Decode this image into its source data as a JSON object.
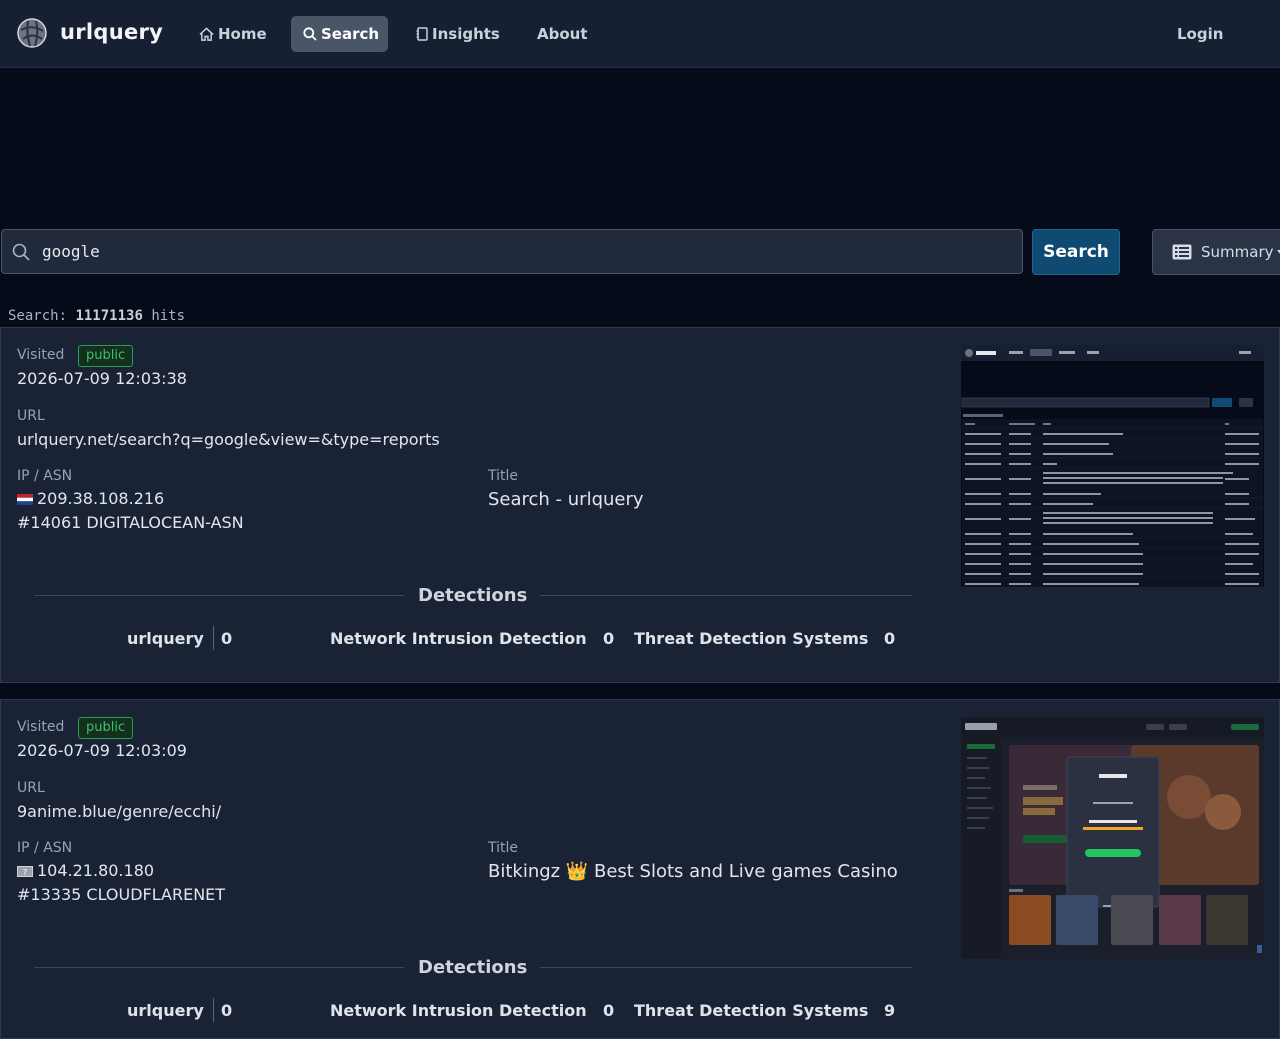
{
  "nav": {
    "brand": "urlquery",
    "home": "Home",
    "search": "Search",
    "insights": "Insights",
    "about": "About",
    "login": "Login"
  },
  "search": {
    "query": "google",
    "button": "Search",
    "view_label": "Summary"
  },
  "hits": {
    "prefix": "Search:",
    "count": "11171136",
    "suffix": "hits"
  },
  "labels": {
    "visited": "Visited",
    "url": "URL",
    "ip_asn": "IP / ASN",
    "title": "Title",
    "detections": "Detections",
    "det_urlquery": "urlquery",
    "det_nids": "Network Intrusion Detection",
    "det_tds": "Threat Detection Systems"
  },
  "results": [
    {
      "visibility": "public",
      "visited": "2026-07-09 12:03:38",
      "url": "urlquery.net/search?q=google&view=&type=reports",
      "ip": "209.38.108.216",
      "asn": "#14061 DIGITALOCEAN-ASN",
      "title": "Search - urlquery",
      "det_urlquery": "0",
      "det_nids": "0",
      "det_tds": "0",
      "flag": "netherlands-flag"
    },
    {
      "visibility": "public",
      "visited": "2026-07-09 12:03:09",
      "url": "9anime.blue/genre/ecchi/",
      "ip": "104.21.80.180",
      "asn": "#13335 CLOUDFLARENET",
      "title": "Bitkingz 👑 Best Slots and Live games Casino",
      "det_urlquery": "0",
      "det_nids": "0",
      "det_tds": "9",
      "flag": "unknown-flag"
    }
  ],
  "colors": {
    "page_bg": "#050b18",
    "navbar_bg": "#172033",
    "card_bg": "#1a2336",
    "search_button": "#0e4a72",
    "badge_green": "#3fbf6a"
  }
}
